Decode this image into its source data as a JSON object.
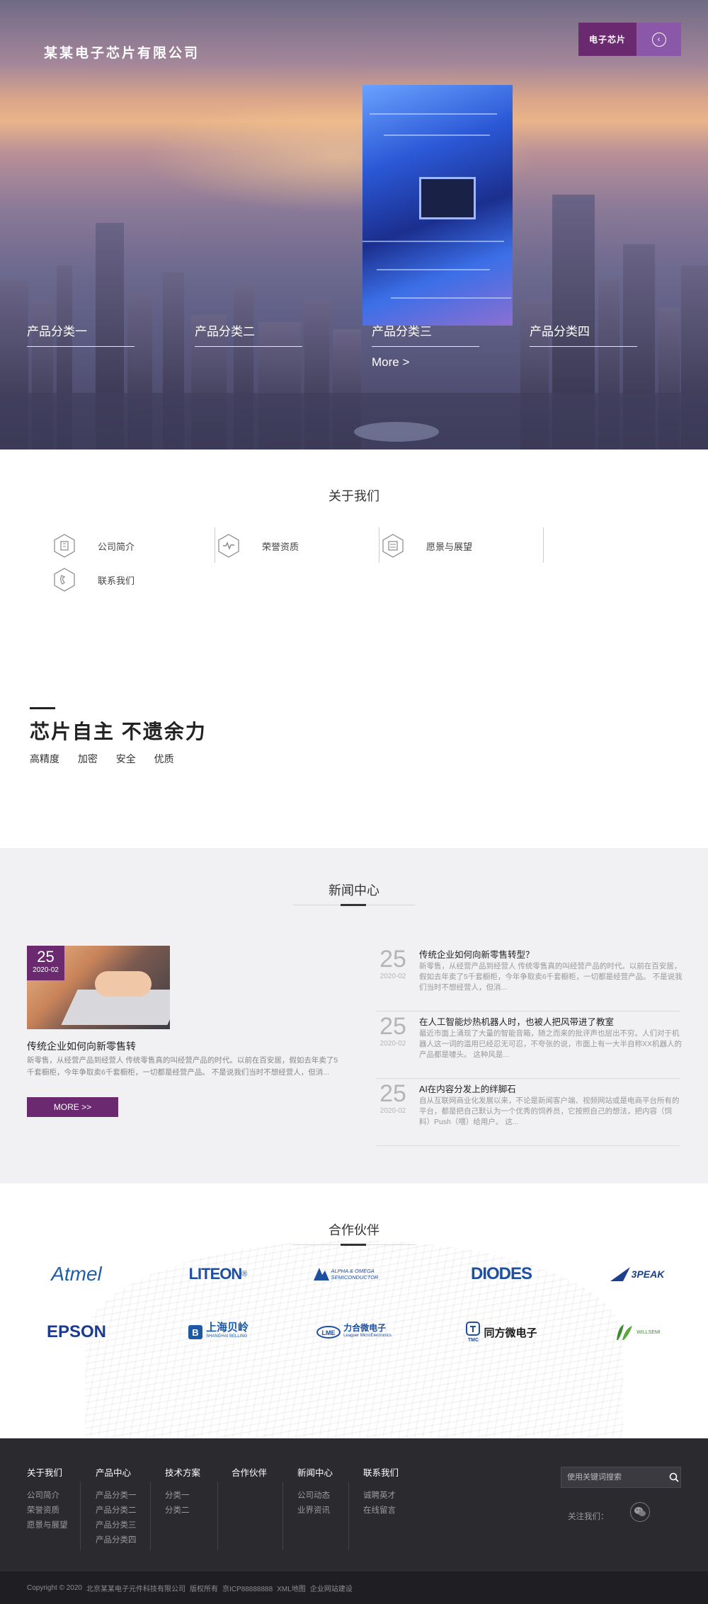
{
  "header": {
    "logo": "某某电子芯片有限公司",
    "badge_label": "电子芯片",
    "categories": [
      "产品分类一",
      "产品分类二",
      "产品分类三",
      "产品分类四"
    ],
    "more_label": "More >"
  },
  "about": {
    "title": "关于我们",
    "items": [
      {
        "label": "公司简介",
        "icon": "building-icon"
      },
      {
        "label": "荣誉资质",
        "icon": "pulse-icon"
      },
      {
        "label": "愿景与展望",
        "icon": "document-icon"
      },
      {
        "label": "联系我们",
        "icon": "phone-icon"
      }
    ],
    "slogan": "芯片自主 不遗余力",
    "tags": [
      "高精度",
      "加密",
      "安全",
      "优质"
    ]
  },
  "news": {
    "title": "新闻中心",
    "featured": {
      "day": "25",
      "ym": "2020-02",
      "title": "传统企业如何向新零售转",
      "desc": "新零售，从经营产品到经营人 传统零售真的叫经营产品的时代。以前在百安居，假如去年卖了5千套橱柜，今年争取卖6千套橱柜，一切都是经营产品。 不是说我们当时不想经营人，但消...",
      "more": "MORE >>"
    },
    "list": [
      {
        "day": "25",
        "ym": "2020-02",
        "title": "传统企业如何向新零售转型？",
        "desc": "新零售，从经营产品到经营人 传统零售真的叫经营产品的时代。以前在百安居，假如去年卖了5千套橱柜，今年争取卖6千套橱柜，一切都是经营产品。 不是说我们当时不想经营人，但消..."
      },
      {
        "day": "25",
        "ym": "2020-02",
        "title": "在人工智能炒热机器人时，也被人把风带进了教室",
        "desc": "最近市面上涌现了大量的智能音箱，随之而来的批评声也层出不穷。人们对于机器人这一词的滥用已经忍无可忍，不夸张的说，市面上有一大半自称XX机器人的产品都是噱头。 这种风是..."
      },
      {
        "day": "25",
        "ym": "2020-02",
        "title": "AI在内容分发上的绊脚石",
        "desc": "自从互联网商业化发展以来，不论是新闻客户端、视频网站或是电商平台所有的平台，都是把自己默认为一个优秀的饲养员，它按照自己的想法，把内容（饲料）Push（喂）给用户。 这..."
      }
    ]
  },
  "partners": {
    "title": "合作伙伴",
    "logos": [
      {
        "name": "Atmel",
        "color": "#1f5ea8"
      },
      {
        "name": "LITEON",
        "color": "#1f4fa0"
      },
      {
        "name": "ALPHA & OMEGA SEMICONDUCTOR",
        "color": "#1f4fa0"
      },
      {
        "name": "DIODES",
        "color": "#1f4fa0"
      },
      {
        "name": "3PEAK",
        "color": "#1c3f8c"
      },
      {
        "name": "EPSON",
        "color": "#1c3a8e"
      },
      {
        "name": "上海贝岭",
        "sub": "SHANGHAI BELLING",
        "color": "#1c5aa8"
      },
      {
        "name": "力合微电子",
        "sub": "Leaguer MicroElectronics",
        "color": "#1f4fa0"
      },
      {
        "name": "同方微电子",
        "sub": "TMC",
        "color": "#1c1c1c"
      },
      {
        "name": "WILLSEMI",
        "color": "#3b8c2e"
      }
    ]
  },
  "footer": {
    "columns": [
      {
        "title": "关于我们",
        "links": [
          "公司简介",
          "荣誉资质",
          "愿景与展望"
        ]
      },
      {
        "title": "产品中心",
        "links": [
          "产品分类一",
          "产品分类二",
          "产品分类三",
          "产品分类四"
        ]
      },
      {
        "title": "技术方案",
        "links": [
          "分类一",
          "分类二"
        ]
      },
      {
        "title": "合作伙伴",
        "links": []
      },
      {
        "title": "新闻中心",
        "links": [
          "公司动态",
          "业界资讯"
        ]
      },
      {
        "title": "联系我们",
        "links": [
          "诚聘英才",
          "在线留言"
        ]
      }
    ],
    "search_placeholder": "使用关键词搜索",
    "follow_label": "关注我们：",
    "copyright": [
      "Copyright © 2020",
      "北京某某电子元件科技有限公司",
      "版权所有",
      "京ICP88888888",
      "XML地图",
      "企业网站建设"
    ]
  },
  "colors": {
    "brand": "#6b2a70",
    "brand_light": "#8b57a8",
    "footer_bg": "#2b2a2e"
  }
}
